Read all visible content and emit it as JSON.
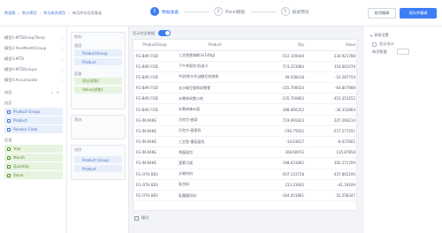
{
  "breadcrumb": [
    "数据集",
    "数仓模型",
    "数仓维表模型",
    "每月库存信息看板"
  ],
  "steps": [
    {
      "num": "1",
      "label": "数据准备"
    },
    {
      "num": "2",
      "label": "Excel模板"
    },
    {
      "num": "3",
      "label": "报表预览"
    }
  ],
  "buttons": {
    "prev": "取消编辑",
    "save": "保存并编辑"
  },
  "datasets": [
    "模型1-MTDGroupTemp",
    "模型2-YearMonthGroup",
    "模型3-MTD",
    "模型4-MTDGroups",
    "模型5-Accumulate"
  ],
  "left": {
    "dimensions_title": "维度",
    "dimension_group": "维度",
    "dimensions": [
      "Product Group",
      "Product",
      "Reason Code"
    ],
    "measures_group": "度量",
    "measures": [
      "Year",
      "Month",
      "Quantity",
      "Value"
    ]
  },
  "config": {
    "title": "指标",
    "rows_label": "维度",
    "row_fields": [
      "ProductGroup",
      "Product"
    ],
    "value_label": "度量",
    "value_fields": [
      "Qty(求和)",
      "Value(求和)"
    ],
    "filter_title": "筛选",
    "order_title": "排序",
    "order_fields": [
      "Product Group",
      "Product"
    ]
  },
  "main": {
    "toggle_label": "显示完全数据",
    "footer_label": "模式",
    "columns": [
      "ProductGroup",
      "Product",
      "Qty",
      "Value"
    ],
    "rows": [
      [
        "FG-BAR FOD",
        "三文鱼煲海鲜汁(140g)",
        "-512.109444",
        "-134.921788"
      ],
      [
        "FG-BAR FOD",
        "下午茶面包·奶油小",
        "574.223884",
        "318.661076"
      ],
      [
        "FG-BAR FOD",
        "牛奶饼(4-6)油酥切块饼柜",
        "49.038418",
        "-10.287754"
      ],
      [
        "FG-BAR FOD",
        "长沙臭豆腐休闲零食",
        "-155.708034",
        "-64.807988"
      ],
      [
        "FG-BAR FOD",
        "水果休闲食小吃",
        "-235.700863",
        "-453.353252"
      ],
      [
        "FG-BAR FOD",
        "水煮肉味炒面",
        "-388.666352",
        "-36.352864"
      ],
      [
        "FG-IN BAKE",
        "巧克力-曲奇",
        "719.991823",
        "247.266214"
      ],
      [
        "FG-IN BAKE",
        "巧克力-甜面包",
        "-746.75932",
        "-217.277251"
      ],
      [
        "FG-IN BAKE",
        "三文鱼-番茄面包",
        "-14.63617",
        "-8.037661"
      ],
      [
        "FG-IN BAKE",
        "鸡蛋面包",
        "308.60972",
        "135.87858"
      ],
      [
        "FG-IN BAKE",
        "菠萝可颂",
        "-198.631862",
        "302.271709"
      ],
      [
        "FG-OTH BEV",
        "水果饮料",
        "-507.133728",
        "-437.862195"
      ],
      [
        "FG-OTH BEV",
        "乳饮料",
        "233.23692",
        "-41.59189"
      ],
      [
        "FG-OTH BEV",
        "乳酸菌饮料",
        "-164.051861",
        "52.258347"
      ]
    ]
  },
  "right": {
    "title": "表格设置",
    "option1": "显示合计",
    "option2": "每页数量"
  }
}
